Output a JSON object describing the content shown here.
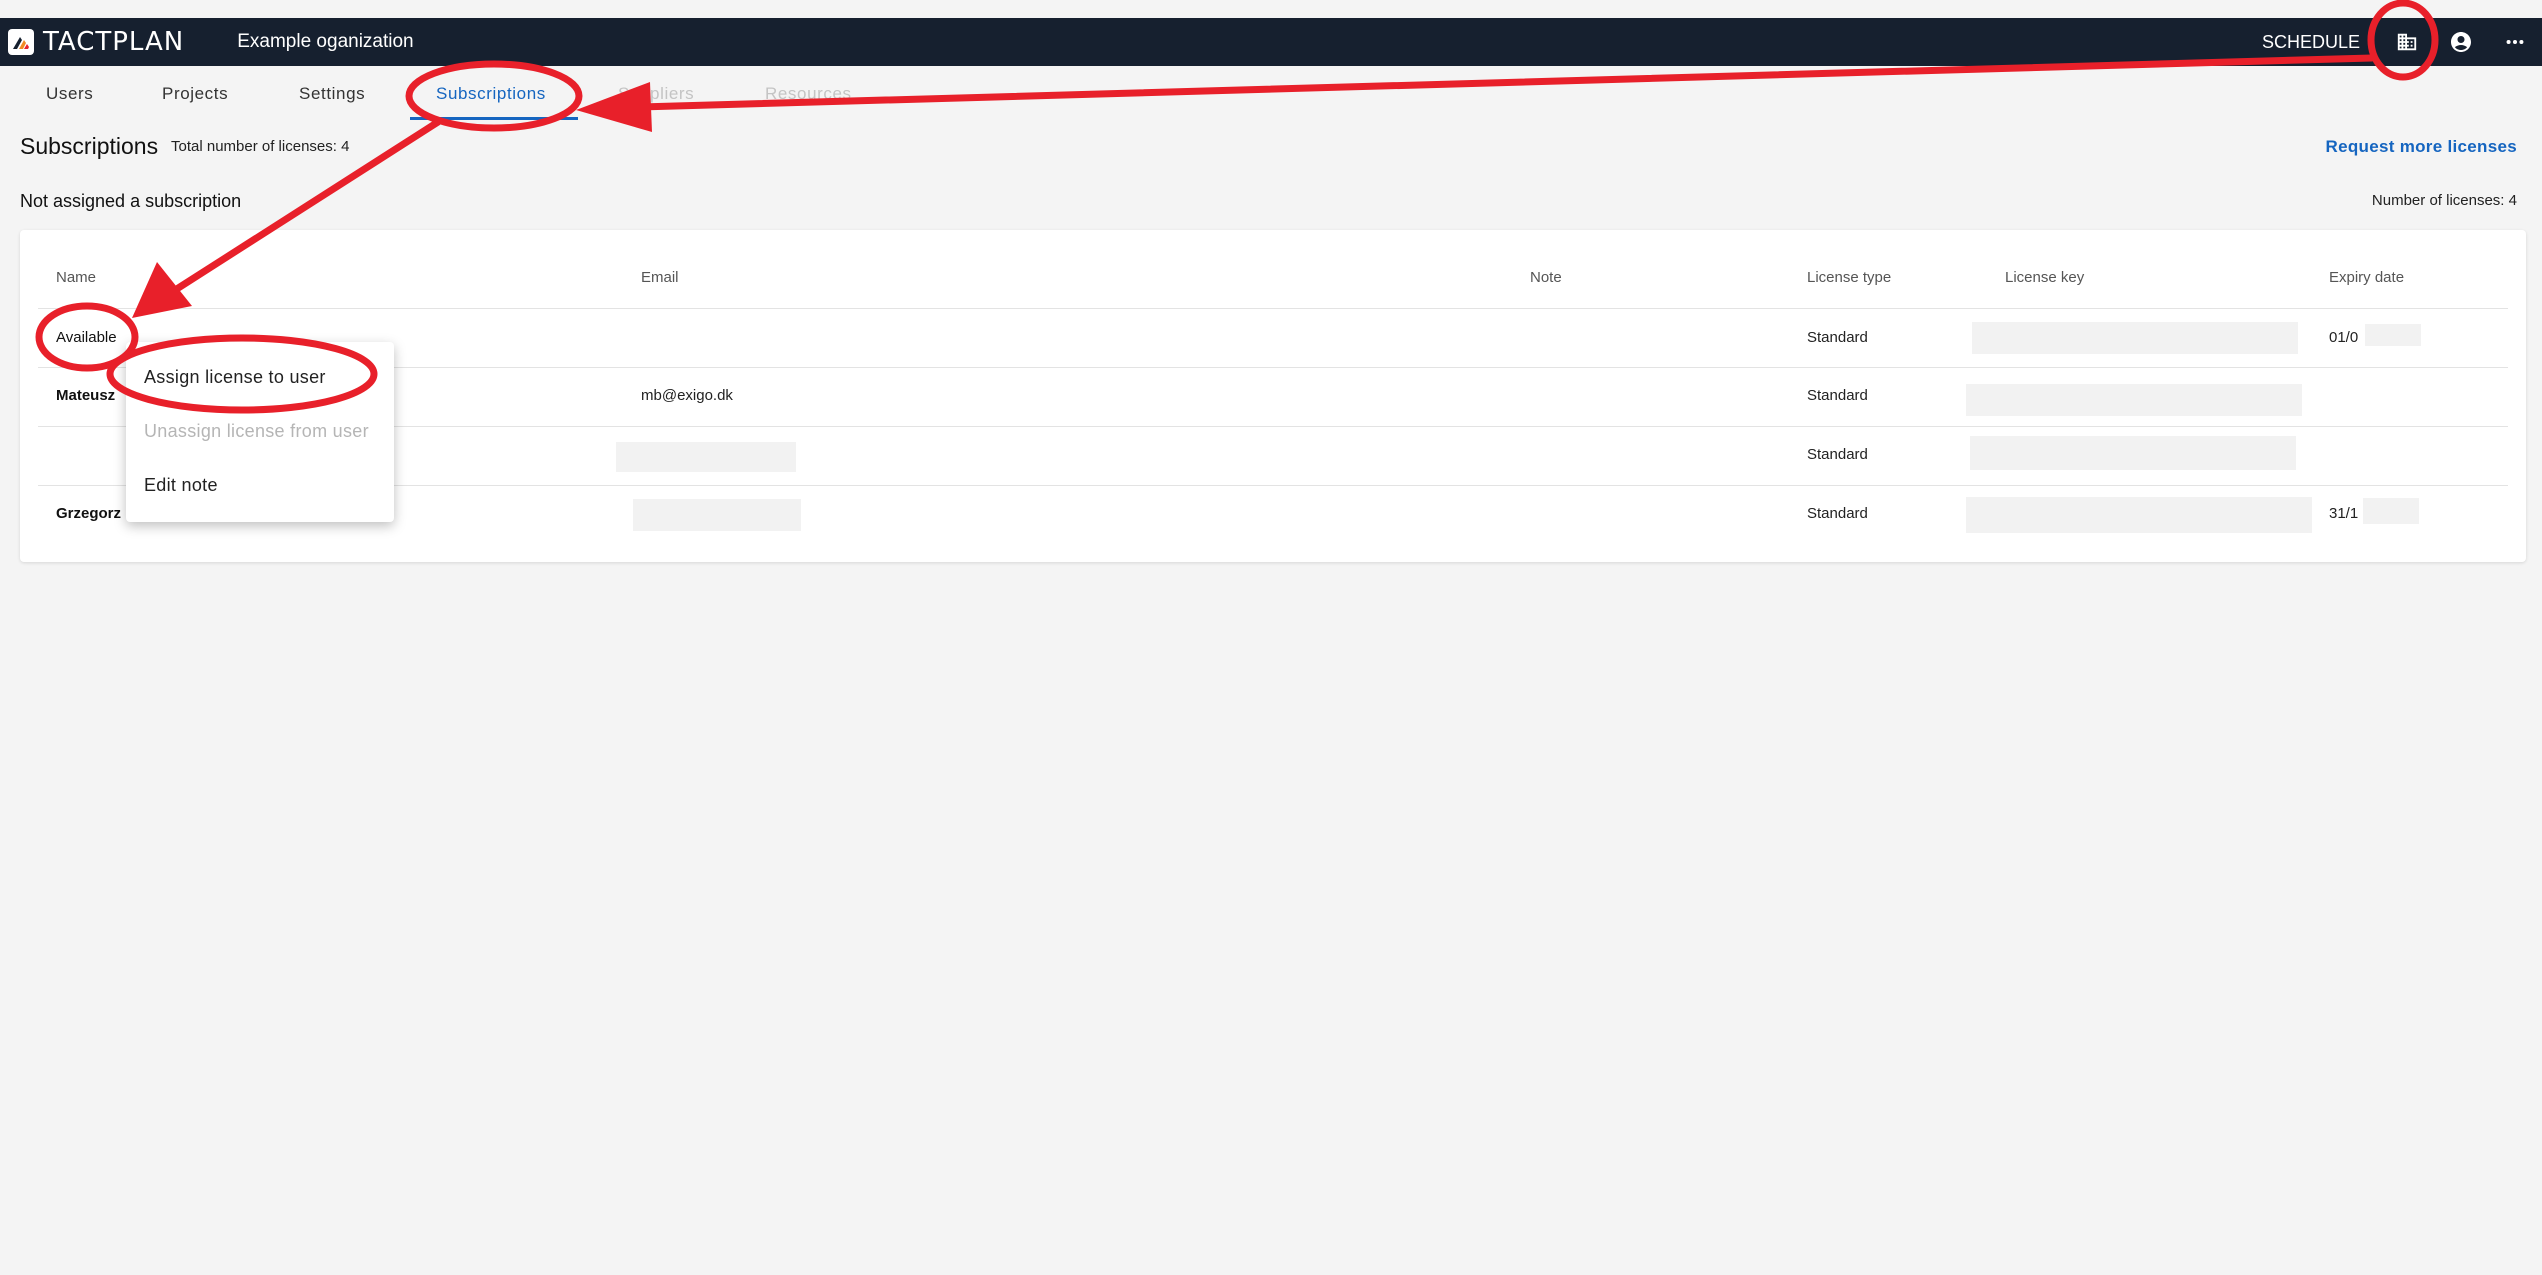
{
  "app": {
    "brand": "TACTPLAN",
    "organization": "Example oganization",
    "schedule_label": "SCHEDULE"
  },
  "icons": {
    "logo": "tactplan-logo-icon",
    "organization": "building-icon",
    "account": "account-circle-icon",
    "more": "more-horizontal-icon"
  },
  "tabs": [
    {
      "label": "Users",
      "state": "normal"
    },
    {
      "label": "Projects",
      "state": "normal"
    },
    {
      "label": "Settings",
      "state": "normal"
    },
    {
      "label": "Subscriptions",
      "state": "active"
    },
    {
      "label": "Suppliers",
      "state": "disabled"
    },
    {
      "label": "Resources",
      "state": "disabled"
    }
  ],
  "subscriptions": {
    "title": "Subscriptions",
    "total_licenses": "Total number of licenses: 4",
    "request_more": "Request more licenses",
    "section_title": "Not assigned a subscription",
    "section_count": "Number of licenses: 4"
  },
  "table": {
    "headers": [
      "Name",
      "Email",
      "Note",
      "License type",
      "License key",
      "Expiry date"
    ],
    "rows": [
      {
        "name": "Available",
        "email": "",
        "note": "",
        "license_type": "Standard",
        "license_key": "",
        "expiry": "01/0"
      },
      {
        "name": "Mateusz",
        "email": "mb@exigo.dk",
        "note": "",
        "license_type": "Standard",
        "license_key": "",
        "expiry": ""
      },
      {
        "name": "",
        "email": "",
        "note": "",
        "license_type": "Standard",
        "license_key": "",
        "expiry": ""
      },
      {
        "name": "Grzegorz",
        "email": "",
        "note": "",
        "license_type": "Standard",
        "license_key": "",
        "expiry": "31/1"
      }
    ]
  },
  "context_menu": {
    "items": [
      {
        "label": "Assign license to user",
        "enabled": true
      },
      {
        "label": "Unassign license from user",
        "enabled": false
      },
      {
        "label": "Edit note",
        "enabled": true
      }
    ]
  },
  "colors": {
    "topbar": "#16202f",
    "accent": "#1565c0",
    "annotation": "#e8202a",
    "background": "#f4f4f4"
  }
}
